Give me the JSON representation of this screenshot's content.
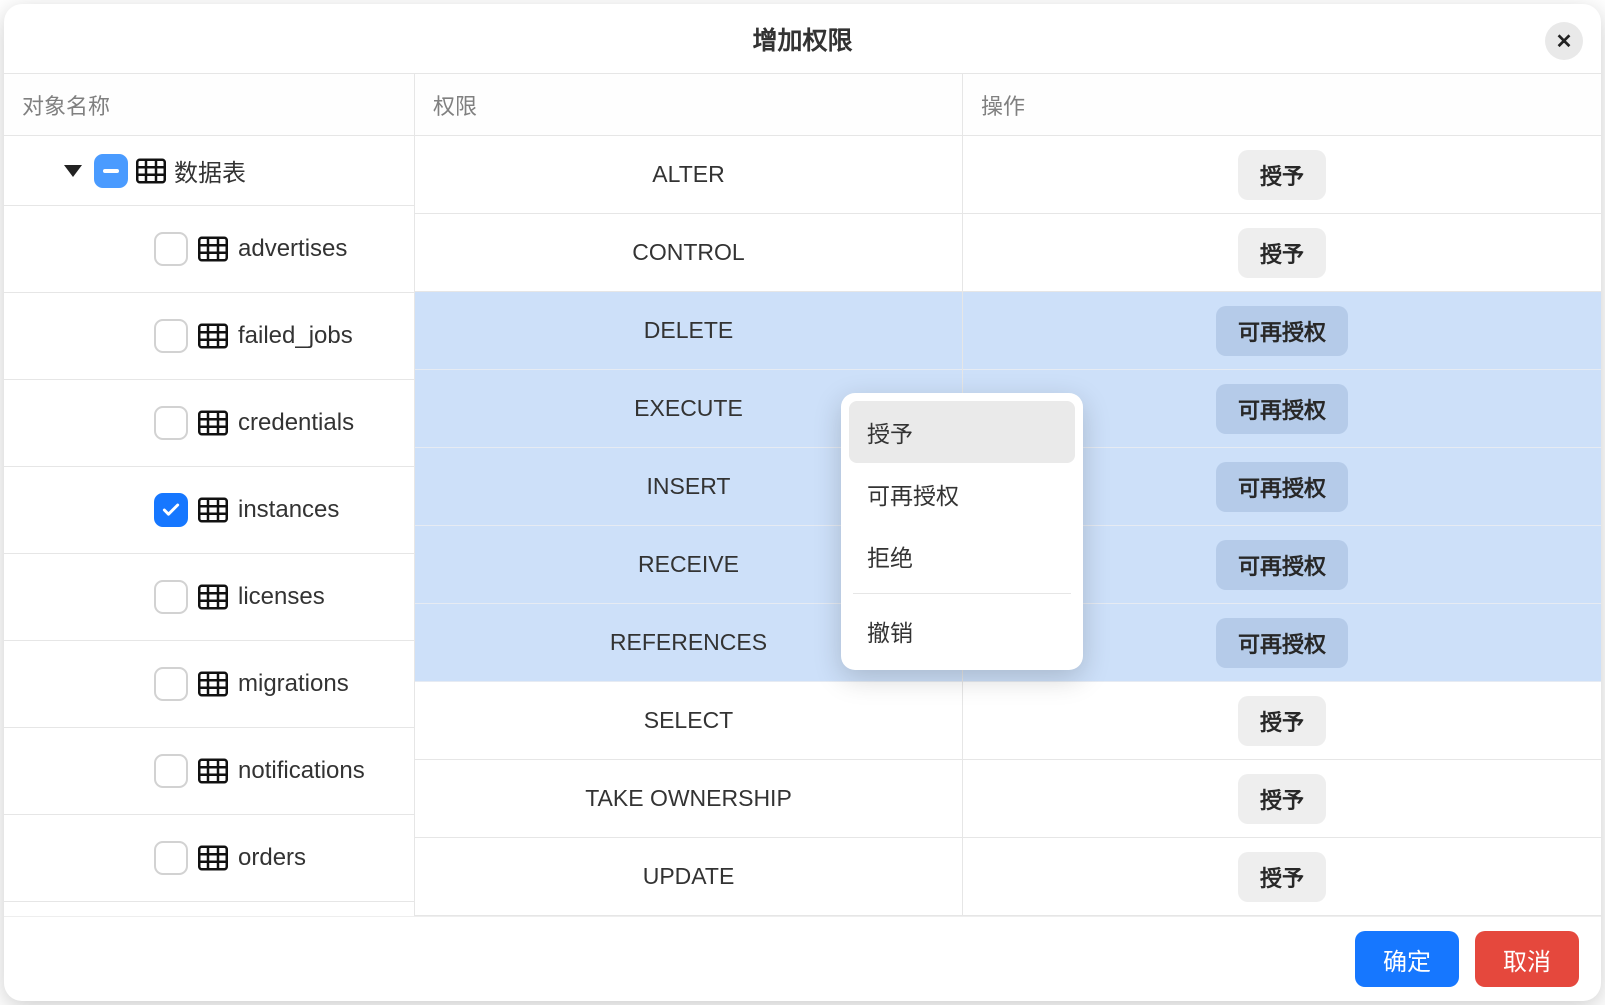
{
  "modal": {
    "title": "增加权限"
  },
  "columns": {
    "object_name": "对象名称",
    "permission": "权限",
    "action": "操作"
  },
  "tree": {
    "root_label": "数据表",
    "items": [
      {
        "label": "advertises",
        "checked": false
      },
      {
        "label": "failed_jobs",
        "checked": false
      },
      {
        "label": "credentials",
        "checked": false
      },
      {
        "label": "instances",
        "checked": true
      },
      {
        "label": "licenses",
        "checked": false
      },
      {
        "label": "migrations",
        "checked": false
      },
      {
        "label": "notifications",
        "checked": false
      },
      {
        "label": "orders",
        "checked": false
      }
    ]
  },
  "permissions": [
    {
      "name": "ALTER",
      "action": "授予",
      "selected": false
    },
    {
      "name": "CONTROL",
      "action": "授予",
      "selected": false
    },
    {
      "name": "DELETE",
      "action": "可再授权",
      "selected": true
    },
    {
      "name": "EXECUTE",
      "action": "可再授权",
      "selected": true
    },
    {
      "name": "INSERT",
      "action": "可再授权",
      "selected": true
    },
    {
      "name": "RECEIVE",
      "action": "可再授权",
      "selected": true
    },
    {
      "name": "REFERENCES",
      "action": "可再授权",
      "selected": true
    },
    {
      "name": "SELECT",
      "action": "授予",
      "selected": false
    },
    {
      "name": "TAKE OWNERSHIP",
      "action": "授予",
      "selected": false
    },
    {
      "name": "UPDATE",
      "action": "授予",
      "selected": false
    }
  ],
  "context_menu": {
    "items": [
      {
        "label": "授予",
        "hover": true
      },
      {
        "label": "可再授权",
        "hover": false
      },
      {
        "label": "拒绝",
        "hover": false
      }
    ],
    "separator_item": {
      "label": "撤销"
    }
  },
  "footer": {
    "confirm": "确定",
    "cancel": "取消"
  }
}
